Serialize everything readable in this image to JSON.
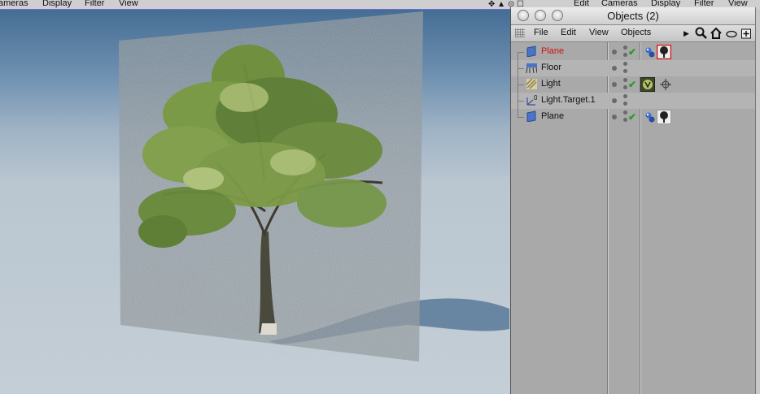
{
  "viewport": {
    "menu": [
      "ameras",
      "Display",
      "Filter",
      "View"
    ]
  },
  "top_menu": [
    "Edit",
    "Cameras",
    "Display",
    "Filter",
    "View"
  ],
  "objects_window": {
    "title": "Objects (2)",
    "menu": [
      "File",
      "Edit",
      "View",
      "Objects"
    ],
    "toolbar_icons": [
      "arrow-right-icon",
      "search-icon",
      "home-icon",
      "ellipse-icon",
      "add-icon"
    ],
    "rows": [
      {
        "name": "Plane",
        "selected": true,
        "icon": "plane-icon",
        "checked": true,
        "tags": [
          "material-icon",
          "tree-texture-icon"
        ]
      },
      {
        "name": "Floor",
        "selected": false,
        "icon": "floor-icon",
        "checked": false,
        "tags": []
      },
      {
        "name": "Light",
        "selected": false,
        "icon": "light-icon",
        "checked": true,
        "tags": [
          "light-tag-icon",
          "target-icon"
        ]
      },
      {
        "name": "Light.Target.1",
        "selected": false,
        "icon": "null-object-icon",
        "checked": false,
        "tags": []
      },
      {
        "name": "Plane",
        "selected": false,
        "icon": "plane-icon",
        "checked": true,
        "tags": [
          "material-icon",
          "tree-texture-icon"
        ]
      }
    ]
  },
  "colors": {
    "selected_text": "#d21010",
    "check_green": "#2a9a2a",
    "sky_top": "#3f6890",
    "floor": "#c4ced6"
  }
}
